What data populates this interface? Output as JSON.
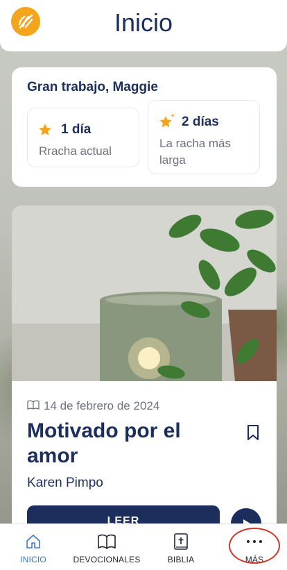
{
  "header": {
    "title": "Inicio",
    "logo_icon": "wheat-logo-icon"
  },
  "streak": {
    "greeting": "Gran trabajo, Maggie",
    "current": {
      "value": "1 día",
      "label": "Rracha actual",
      "icon": "star-icon"
    },
    "longest": {
      "value": "2 días",
      "label": "La racha más larga",
      "icon": "sparkle-star-icon"
    }
  },
  "devotional": {
    "date": "14 de febrero de 2024",
    "date_icon": "open-book-icon",
    "title": "Motivado por el amor",
    "author": "Karen Pimpo",
    "read_label": "LEER",
    "bookmark_icon": "bookmark-icon",
    "play_icon": "play-icon"
  },
  "tabs": [
    {
      "label": "INICIO",
      "icon": "home-icon",
      "active": true
    },
    {
      "label": "DEVOCIONALES",
      "icon": "book-icon",
      "active": false
    },
    {
      "label": "BIBLIA",
      "icon": "bible-icon",
      "active": false
    },
    {
      "label": "MÁS",
      "icon": "more-dots-icon",
      "active": false
    }
  ],
  "colors": {
    "navy": "#1b2e5c",
    "accent_orange": "#f3a51c",
    "active_tab": "#3d78c6",
    "annotation_red": "#d0362a"
  }
}
